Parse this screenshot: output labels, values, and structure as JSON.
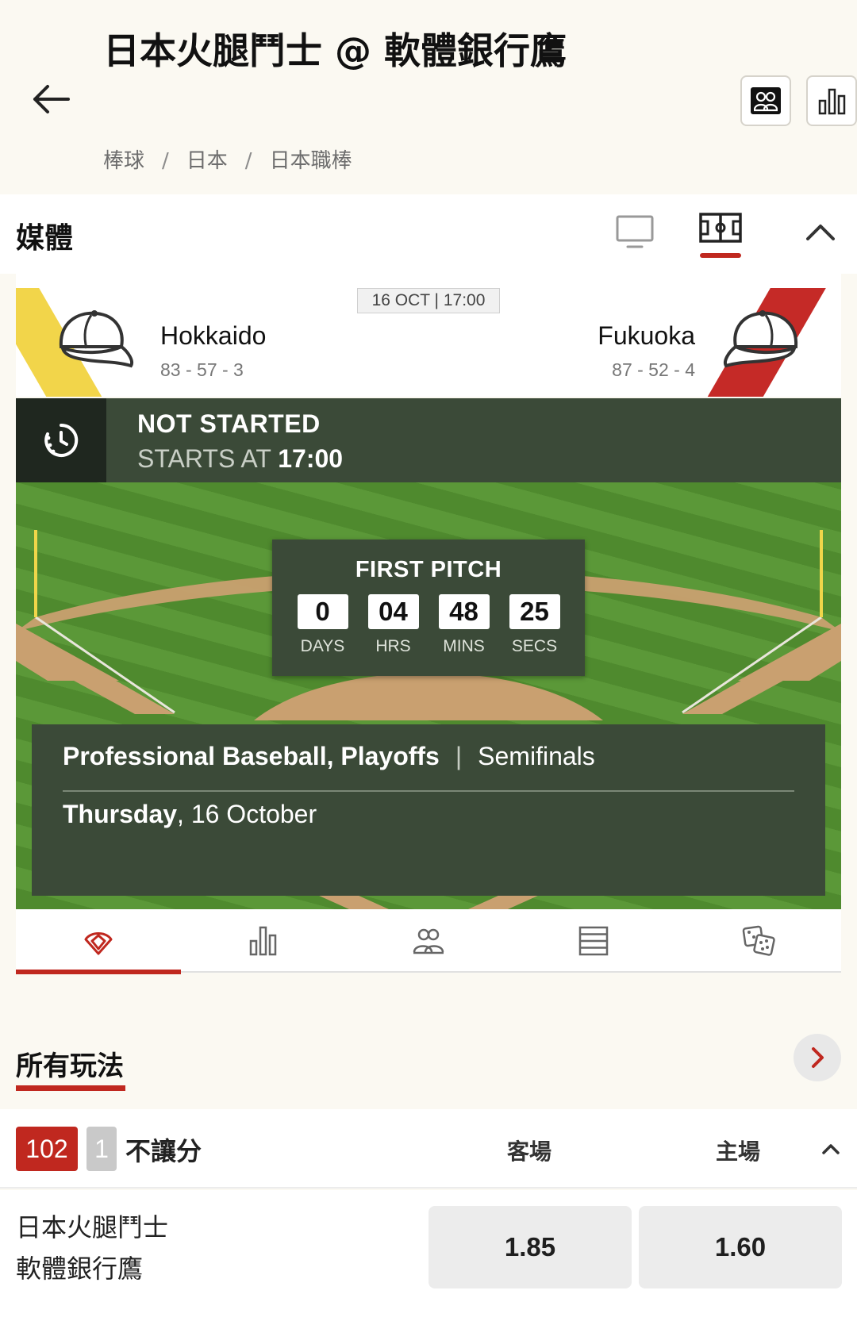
{
  "header": {
    "title": "日本火腿鬥士 @ 軟體銀行鷹",
    "breadcrumbs": [
      "棒球",
      "日本",
      "日本職棒"
    ],
    "breadcrumb_separator": "/"
  },
  "media": {
    "title": "媒體"
  },
  "match": {
    "datetime_pill": "16 OCT | 17:00",
    "home": {
      "name": "Hokkaido",
      "record": "83 - 57 - 3",
      "color": "#f2d54a"
    },
    "away": {
      "name": "Fukuoka",
      "record": "87 - 52 - 4",
      "color": "#c52a27"
    }
  },
  "status": {
    "main": "NOT STARTED",
    "starts_label": "STARTS AT",
    "starts_time": "17:00"
  },
  "countdown": {
    "title": "FIRST PITCH",
    "units": [
      {
        "value": "0",
        "label": "DAYS"
      },
      {
        "value": "04",
        "label": "HRS"
      },
      {
        "value": "48",
        "label": "MINS"
      },
      {
        "value": "25",
        "label": "SECS"
      }
    ]
  },
  "info": {
    "competition": "Professional Baseball, Playoffs",
    "stage": "Semifinals",
    "weekday": "Thursday",
    "date": ", 16 October"
  },
  "tabs": [
    {
      "icon": "baseball-diamond-icon",
      "active": true
    },
    {
      "icon": "bar-chart-icon",
      "active": false
    },
    {
      "icon": "lineup-icon",
      "active": false
    },
    {
      "icon": "standings-table-icon",
      "active": false
    },
    {
      "icon": "dice-icon",
      "active": false
    }
  ],
  "markets": {
    "title": "所有玩法",
    "market": {
      "code": "102",
      "index": "1",
      "name": "不讓分",
      "col_away": "客場",
      "col_home": "主場",
      "team1": "日本火腿鬥士",
      "team2": "軟體銀行鷹",
      "odds_away": "1.85",
      "odds_home": "1.60"
    }
  },
  "colors": {
    "accent": "#c0281f",
    "panel": "#3b4a38",
    "panel_dark": "#1f271f",
    "grass": "#5b9838",
    "dirt": "#c9a070"
  }
}
